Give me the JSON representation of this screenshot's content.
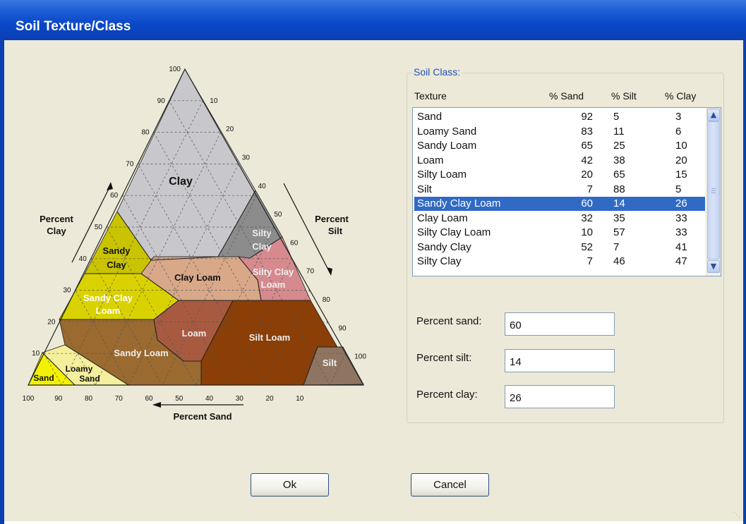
{
  "window": {
    "title": "Soil Texture/Class"
  },
  "triangle": {
    "regions": {
      "clay": "Clay",
      "sandy_clay": [
        "Sandy",
        "Clay"
      ],
      "silty_clay": [
        "Silty",
        "Clay"
      ],
      "clay_loam": "Clay Loam",
      "silty_clay_loam": [
        "Silty Clay",
        "Loam"
      ],
      "sandy_clay_loam": [
        "Sandy Clay",
        "Loam"
      ],
      "loam": "Loam",
      "silt_loam": "Silt Loam",
      "sandy_loam": "Sandy Loam",
      "silt": "Silt",
      "loamy_sand": [
        "Loamy",
        "Sand"
      ],
      "sand": "Sand"
    },
    "clay_axis_title": [
      "Percent",
      "Clay"
    ],
    "silt_axis_title": [
      "Percent",
      "Silt"
    ],
    "sand_axis_title": "Percent Sand",
    "clay_ticks": [
      "100",
      "90",
      "80",
      "70",
      "60",
      "50",
      "40",
      "30",
      "20",
      "10"
    ],
    "silt_ticks": [
      "10",
      "20",
      "30",
      "40",
      "50",
      "60",
      "70",
      "80",
      "90",
      "100"
    ],
    "sand_ticks": [
      "100",
      "90",
      "80",
      "70",
      "60",
      "50",
      "40",
      "30",
      "20",
      "10"
    ],
    "colors": {
      "clay": "#c8c8cc",
      "sandy_clay": "#c9c300",
      "silty_clay": "#8c8c8c",
      "clay_loam": "#d8a888",
      "silty_clay_loam": "#d68a8e",
      "sandy_clay_loam": "#dad200",
      "loam": "#a85a40",
      "silt_loam": "#8b3e05",
      "sandy_loam": "#9a6a30",
      "silt": "#8f7462",
      "loamy_sand": "#f4ef9c",
      "sand": "#f2f200"
    }
  },
  "soil_class": {
    "group_label": "Soil Class:",
    "headers": {
      "texture": "Texture",
      "sand": "% Sand",
      "silt": "% Silt",
      "clay": "% Clay"
    },
    "rows": [
      {
        "texture": "Sand",
        "sand": "92",
        "silt": "5",
        "clay": "3"
      },
      {
        "texture": "Loamy Sand",
        "sand": "83",
        "silt": "11",
        "clay": "6"
      },
      {
        "texture": "Sandy Loam",
        "sand": "65",
        "silt": "25",
        "clay": "10"
      },
      {
        "texture": "Loam",
        "sand": "42",
        "silt": "38",
        "clay": "20"
      },
      {
        "texture": "Silty Loam",
        "sand": "20",
        "silt": "65",
        "clay": "15"
      },
      {
        "texture": "Silt",
        "sand": "7",
        "silt": "88",
        "clay": "5"
      },
      {
        "texture": "Sandy Clay Loam",
        "sand": "60",
        "silt": "14",
        "clay": "26"
      },
      {
        "texture": "Clay Loam",
        "sand": "32",
        "silt": "35",
        "clay": "33"
      },
      {
        "texture": "Silty Clay Loam",
        "sand": "10",
        "silt": "57",
        "clay": "33"
      },
      {
        "texture": "Sandy Clay",
        "sand": "52",
        "silt": "7",
        "clay": "41"
      },
      {
        "texture": "Silty Clay",
        "sand": "7",
        "silt": "46",
        "clay": "47"
      }
    ],
    "selected_index": 6
  },
  "fields": {
    "sand": {
      "label": "Percent sand:",
      "value": "60"
    },
    "silt": {
      "label": "Percent silt:",
      "value": "14"
    },
    "clay": {
      "label": "Percent clay:",
      "value": "26"
    }
  },
  "buttons": {
    "ok": "Ok",
    "cancel": "Cancel"
  }
}
